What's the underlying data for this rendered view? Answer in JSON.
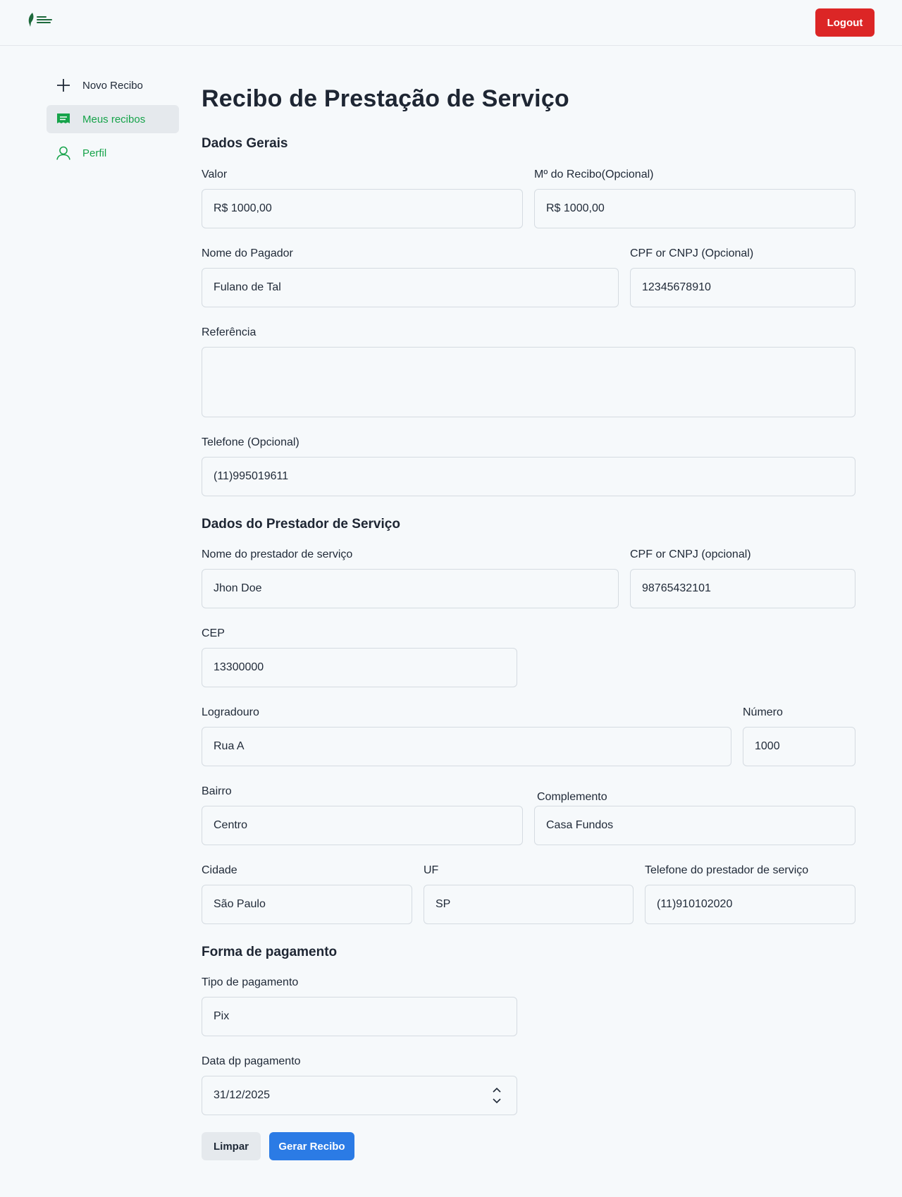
{
  "header": {
    "logout_label": "Logout"
  },
  "sidebar": {
    "items": [
      {
        "label": "Novo Recibo",
        "icon": "plus-icon"
      },
      {
        "label": "Meus recibos",
        "icon": "receipt-icon"
      },
      {
        "label": "Perfil",
        "icon": "user-icon"
      }
    ]
  },
  "page": {
    "title": "Recibo de Prestação de Serviço"
  },
  "general": {
    "section_title": "Dados Gerais",
    "valor_label": "Valor",
    "valor_value": "R$ 1000,00",
    "numero_recibo_label": "Mº do Recibo(Opcional)",
    "numero_recibo_value": "R$ 1000,00",
    "pagador_label": "Nome do Pagador",
    "pagador_value": "Fulano de Tal",
    "cpf_pagador_label": "CPF or CNPJ (Opcional)",
    "cpf_pagador_value": "12345678910",
    "referencia_label": "Referência",
    "referencia_value": "",
    "telefone_label": "Telefone (Opcional)",
    "telefone_value": "(11)995019611"
  },
  "provider": {
    "section_title": "Dados do Prestador de Serviço",
    "nome_label": "Nome do prestador de serviço",
    "nome_value": "Jhon Doe",
    "cpf_label": "CPF or CNPJ (opcional)",
    "cpf_value": "98765432101",
    "cep_label": "CEP",
    "cep_value": "13300000",
    "logradouro_label": "Logradouro",
    "logradouro_value": "Rua A",
    "numero_label": "Número",
    "numero_value": "1000",
    "bairro_label": "Bairro",
    "bairro_value": "Centro",
    "complemento_label": "Complemento",
    "complemento_value": "Casa Fundos",
    "cidade_label": "Cidade",
    "cidade_value": "São Paulo",
    "uf_label": "UF",
    "uf_value": "SP",
    "telefone_label": "Telefone do prestador de serviço",
    "telefone_value": "(11)910102020"
  },
  "payment": {
    "section_title": "Forma de pagamento",
    "tipo_label": "Tipo de pagamento",
    "tipo_value": "Pix",
    "data_label": "Data dp pagamento",
    "data_value": "31/12/2025"
  },
  "actions": {
    "clear_label": "Limpar",
    "submit_label": "Gerar Recibo"
  },
  "colors": {
    "accent_green": "#16a34a",
    "logout_red": "#dc2626",
    "primary_blue": "#2b7be5"
  }
}
